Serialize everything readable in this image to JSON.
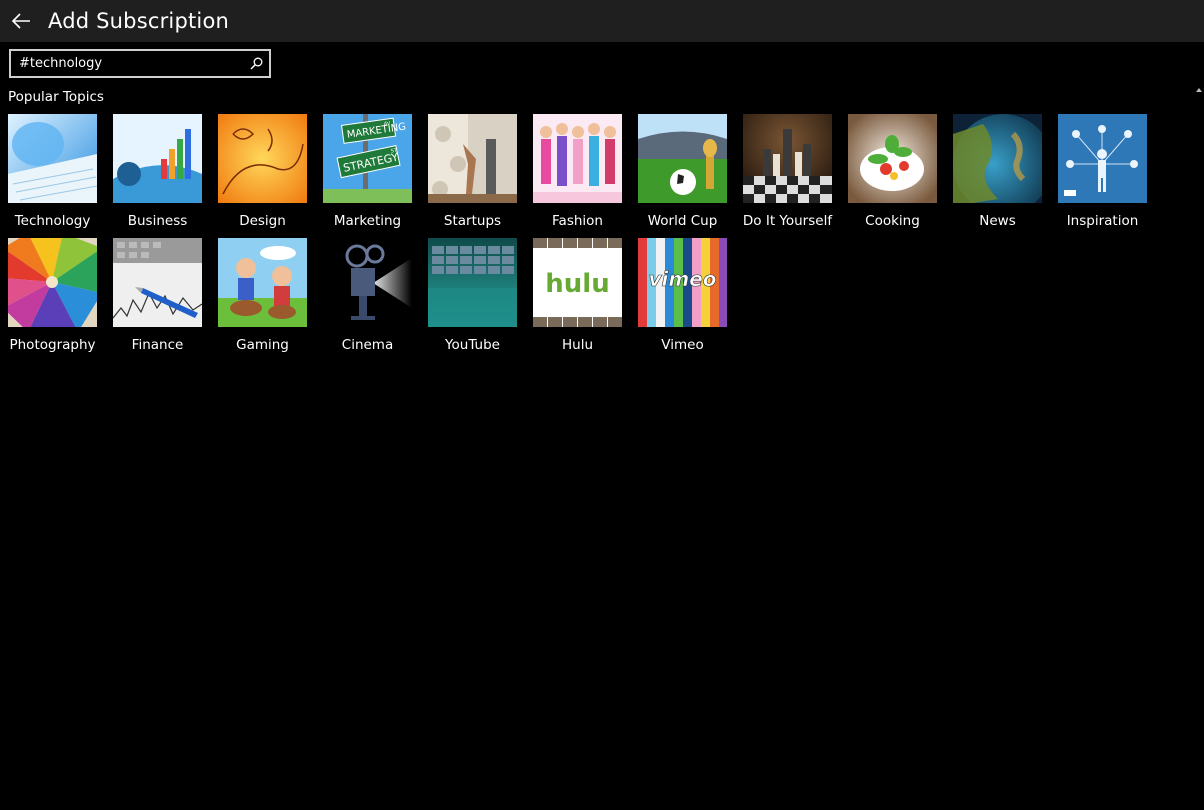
{
  "header": {
    "title": "Add Subscription",
    "back_icon": "arrow-left-icon"
  },
  "search": {
    "value": "#technology",
    "placeholder": "",
    "icon": "search-icon"
  },
  "section": {
    "title": "Popular Topics"
  },
  "topics": [
    {
      "label": "Technology"
    },
    {
      "label": "Business"
    },
    {
      "label": "Design"
    },
    {
      "label": "Marketing",
      "sign_top": "MARKETING",
      "sign_top_sup": "AV",
      "sign_bottom": "STRATEGY",
      "sign_bottom_sup": "ST"
    },
    {
      "label": "Startups"
    },
    {
      "label": "Fashion"
    },
    {
      "label": "World Cup"
    },
    {
      "label": "Do It Yourself"
    },
    {
      "label": "Cooking"
    },
    {
      "label": "News"
    },
    {
      "label": "Inspiration"
    },
    {
      "label": "Photography"
    },
    {
      "label": "Finance"
    },
    {
      "label": "Gaming"
    },
    {
      "label": "Cinema"
    },
    {
      "label": "YouTube"
    },
    {
      "label": "Hulu",
      "logo_text": "hulu"
    },
    {
      "label": "Vimeo",
      "logo_text": "vimeo"
    }
  ],
  "colors": {
    "titlebar": "#1f1f1f",
    "background": "#000000",
    "text": "#ffffff"
  }
}
